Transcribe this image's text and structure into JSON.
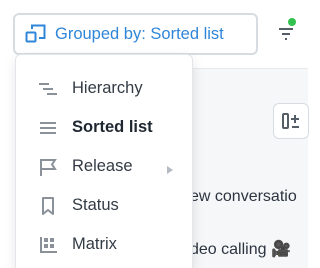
{
  "toolbar": {
    "group_button_label": "Grouped by: Sorted list",
    "group_button_icon": "group-by-icon",
    "filter_icon": "filter-icon",
    "filter_active": true,
    "filter_dot_color": "#32c24d",
    "accent_color": "#2f86d8"
  },
  "menu": {
    "items": [
      {
        "label": "Hierarchy",
        "icon": "hierarchy-icon",
        "selected": false,
        "has_submenu": false
      },
      {
        "label": "Sorted list",
        "icon": "sorted-list-icon",
        "selected": true,
        "has_submenu": false
      },
      {
        "label": "Release",
        "icon": "release-flag-icon",
        "selected": false,
        "has_submenu": true
      },
      {
        "label": "Status",
        "icon": "bookmark-icon",
        "selected": false,
        "has_submenu": false
      },
      {
        "label": "Matrix",
        "icon": "matrix-icon",
        "selected": false,
        "has_submenu": false
      }
    ]
  },
  "background": {
    "add_column_icon": "add-column-icon",
    "row1_text": "ew conversatio",
    "row2_text": "deo calling 🎥"
  }
}
